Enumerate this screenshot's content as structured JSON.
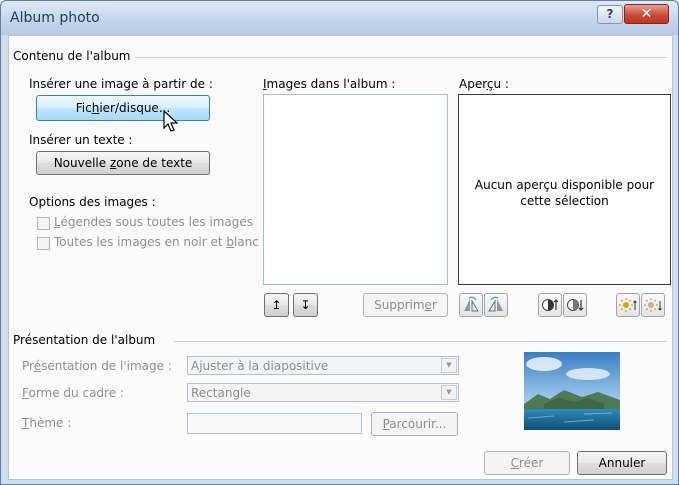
{
  "window": {
    "title": "Album photo",
    "help_glyph": "?",
    "close_glyph": "✕"
  },
  "album_content": {
    "legend": "Contenu de l'album",
    "insert_image_from": "Insérer une image à partir de :",
    "file_button": {
      "pre": "Fic",
      "mnemonic": "h",
      "post": "ier/disque..."
    },
    "insert_text": "Insérer un texte :",
    "new_textbox_button": {
      "pre": "Nouvelle ",
      "mnemonic": "z",
      "post": "one de texte"
    },
    "picture_options": "Options des images :",
    "captions_checkbox": {
      "mnemonic": "L",
      "post": "égendes sous toutes les images"
    },
    "bw_checkbox": {
      "pre": "Toutes les images en noir et ",
      "mnemonic": "b",
      "post": "lanc"
    },
    "pictures_in_album": {
      "mnemonic": "I",
      "post": "mages dans l'album :"
    },
    "preview": {
      "pre": "Aper",
      "mnemonic": "ç",
      "post": "u :",
      "empty_line1": "Aucun aperçu disponible pour",
      "empty_line2": "cette sélection"
    },
    "move_up_glyph": "↥",
    "move_down_glyph": "↧",
    "remove_button": {
      "pre": "Supprim",
      "mnemonic": "e",
      "post": "r"
    }
  },
  "album_layout": {
    "legend": "Présentation de l'album",
    "picture_layout": {
      "pre": "Pr",
      "mnemonic": "é",
      "post": "sentation de l'image :",
      "value": "Ajuster à la diapositive"
    },
    "frame_shape": {
      "mnemonic": "F",
      "post": "orme du cadre :",
      "value": "Rectangle"
    },
    "theme": {
      "mnemonic": "T",
      "post": "hème :",
      "value": ""
    },
    "browse_button": {
      "mnemonic": "P",
      "post": "arcourir..."
    }
  },
  "footer": {
    "create_button": {
      "mnemonic": "C",
      "post": "réer"
    },
    "cancel_button": "Annuler"
  },
  "colors": {
    "title_text": "#1e395b",
    "close_button": "#c2361f",
    "preview_border": "#3a3a3a"
  },
  "icons": [
    "help-icon",
    "close-icon",
    "cursor-icon",
    "move-up-icon",
    "move-down-icon",
    "rotate-left-icon",
    "rotate-right-icon",
    "contrast-up-icon",
    "contrast-down-icon",
    "brightness-up-icon",
    "brightness-down-icon",
    "landscape-thumbnail"
  ]
}
